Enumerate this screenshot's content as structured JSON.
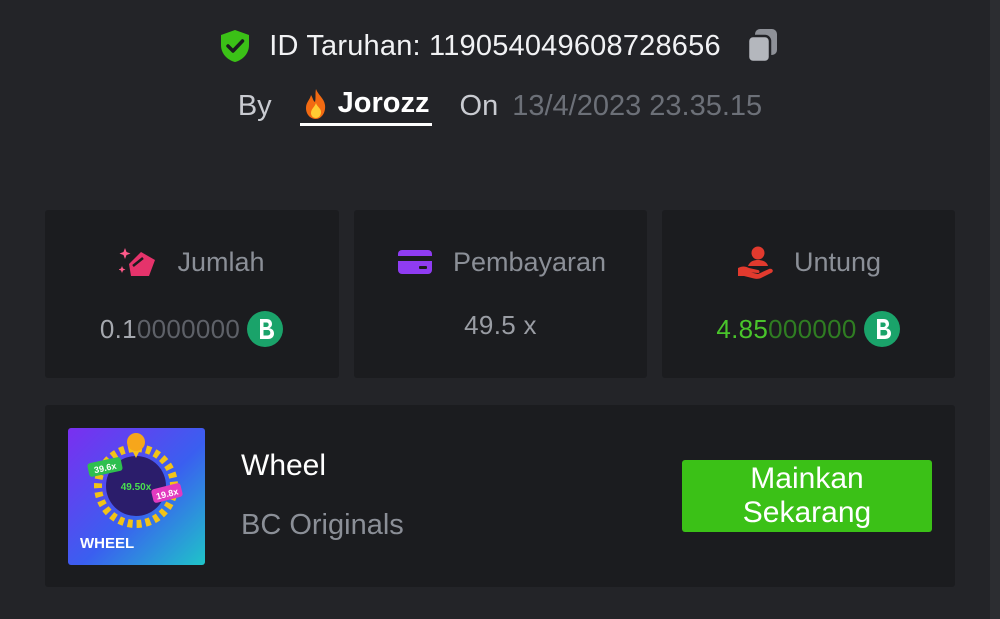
{
  "header": {
    "bet_id_label": "ID Taruhan: 119054049608728656",
    "by_label": "By",
    "username": "Jorozz",
    "on_label": "On",
    "date": "13/4/2023 23.35.15"
  },
  "stats": [
    {
      "label": "Jumlah",
      "icon": "bet-amount-icon",
      "value_strong": "0.1",
      "value_dim": "0000000",
      "coin": "bc-coin-icon"
    },
    {
      "label": "Pembayaran",
      "icon": "payment-card-icon",
      "value": "49.5 x"
    },
    {
      "label": "Untung",
      "icon": "profit-hand-icon",
      "value_strong": "4.85",
      "value_dim": "000000",
      "coin": "bc-coin-icon"
    }
  ],
  "game": {
    "name": "Wheel",
    "provider": "BC Originals",
    "play_label": "Mainkan Sekarang",
    "thumb": {
      "title": "WHEEL",
      "multipliers": [
        "39.6x",
        "49.50x",
        "19.8x"
      ]
    }
  },
  "colors": {
    "background": "#232428",
    "card": "#1b1c1f",
    "accent_green": "#3bc117",
    "profit_green": "#49c52b",
    "muted_text": "#8b8f97"
  }
}
